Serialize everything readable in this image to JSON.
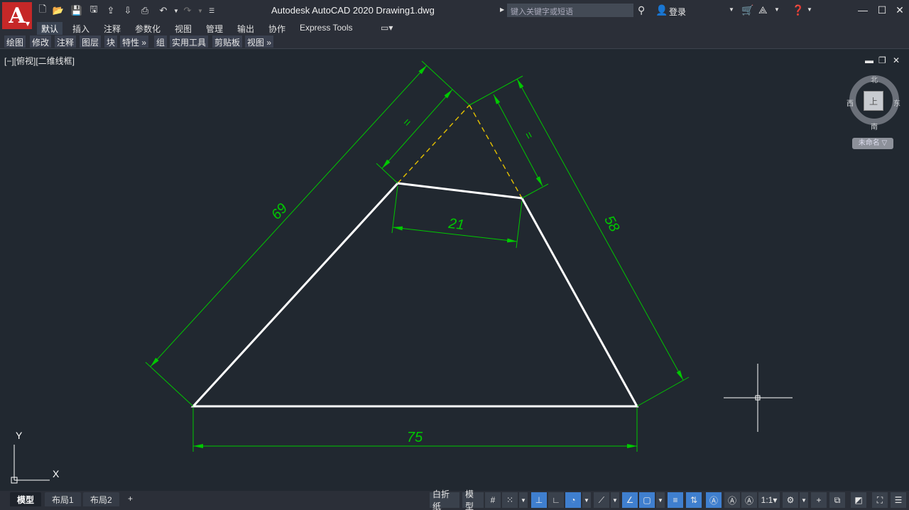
{
  "title_bar": {
    "app_title": "Autodesk AutoCAD 2020    Drawing1.dwg",
    "search_placeholder": "键入关键字或短语",
    "login_label": "登录",
    "logo_letter": "A"
  },
  "ribbon_tabs": [
    "默认",
    "插入",
    "注释",
    "参数化",
    "视图",
    "管理",
    "输出",
    "协作",
    "Express Tools"
  ],
  "active_tab": "默认",
  "panels": [
    "绘图",
    "修改",
    "注释",
    "图层",
    "块",
    "特性",
    "组",
    "实用工具",
    "剪贴板",
    "视图"
  ],
  "viewport": {
    "label": "[−][俯视][二维线框]"
  },
  "viewcube": {
    "north": "北",
    "south": "南",
    "east": "东",
    "west": "西",
    "face": "上",
    "wcs_label": "未命名"
  },
  "dimensions": {
    "bottom": "75",
    "left": "69",
    "right": "58",
    "inner": "21",
    "eq_left": "=",
    "eq_right": "="
  },
  "ucs": {
    "x_label": "X",
    "y_label": "Y"
  },
  "layout_tabs": [
    "模型",
    "布局1",
    "布局2"
  ],
  "active_layout": "模型",
  "status_bar": {
    "paper_label": "白折纸",
    "model_label": "模型",
    "scale_label": "1:1"
  },
  "colors": {
    "background": "#212830",
    "dimension": "#00c800",
    "geometry": "#ffffff",
    "hidden": "#e6c200",
    "logo": "#c62828"
  }
}
